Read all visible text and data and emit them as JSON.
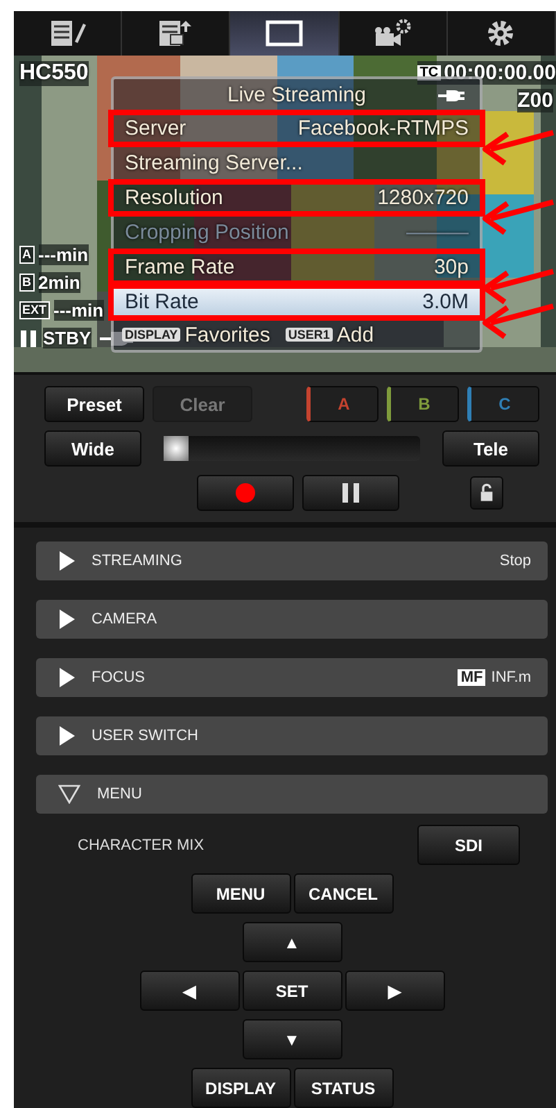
{
  "tabs": [
    {
      "selected": false
    },
    {
      "selected": false
    },
    {
      "selected": true
    },
    {
      "selected": false
    },
    {
      "selected": false
    }
  ],
  "preview": {
    "model": "HC550",
    "tc_badge": "TC",
    "timecode": "00:00:00.00",
    "zoom": "Z00",
    "media": [
      {
        "badge": "A",
        "text": "---min"
      },
      {
        "badge": "B",
        "text": "2min"
      },
      {
        "badge": "EXT",
        "text": "---min"
      }
    ],
    "status": "STBY",
    "menu": {
      "title": "Live Streaming",
      "items": [
        {
          "label": "Server",
          "value": "Facebook-RTMPS",
          "selected": false,
          "disabled": false,
          "annotated": true
        },
        {
          "label": "Streaming Server...",
          "selected": false,
          "disabled": false,
          "annotated": false
        },
        {
          "label": "Resolution",
          "value": "1280x720",
          "selected": false,
          "disabled": false,
          "annotated": true
        },
        {
          "label": "Cropping Position",
          "value": "———",
          "selected": false,
          "disabled": true,
          "annotated": false
        },
        {
          "label": "Frame Rate",
          "value": "30p",
          "selected": false,
          "disabled": false,
          "annotated": true
        },
        {
          "label": "Bit Rate",
          "value": "3.0M",
          "selected": true,
          "disabled": false,
          "annotated": true
        }
      ],
      "footer": [
        {
          "badge": "DISPLAY",
          "text": "Favorites"
        },
        {
          "badge": "USER1",
          "text": "Add"
        }
      ]
    }
  },
  "controls": {
    "preset": "Preset",
    "clear": {
      "label": "Clear",
      "disabled": true
    },
    "memories": [
      {
        "label": "A",
        "color": "#c4432f"
      },
      {
        "label": "B",
        "color": "#7f9b3c"
      },
      {
        "label": "C",
        "color": "#2f7fb5"
      }
    ],
    "wide": "Wide",
    "tele": "Tele",
    "zoom": {
      "level": 0
    }
  },
  "sections": [
    {
      "title": "STREAMING",
      "expanded": false,
      "value": "Stop"
    },
    {
      "title": "CAMERA",
      "expanded": false
    },
    {
      "title": "FOCUS",
      "expanded": false,
      "badge": "MF",
      "value": "INF.m"
    },
    {
      "title": "USER SWITCH",
      "expanded": false
    },
    {
      "title": "MENU",
      "expanded": true
    }
  ],
  "menu_panel": {
    "character_mix": "CHARACTER MIX",
    "output": "SDI",
    "menu": "MENU",
    "cancel": "CANCEL",
    "up": "▲",
    "left": "◀",
    "set": "SET",
    "right": "▶",
    "down": "▼",
    "display": "DISPLAY",
    "status": "STATUS"
  }
}
